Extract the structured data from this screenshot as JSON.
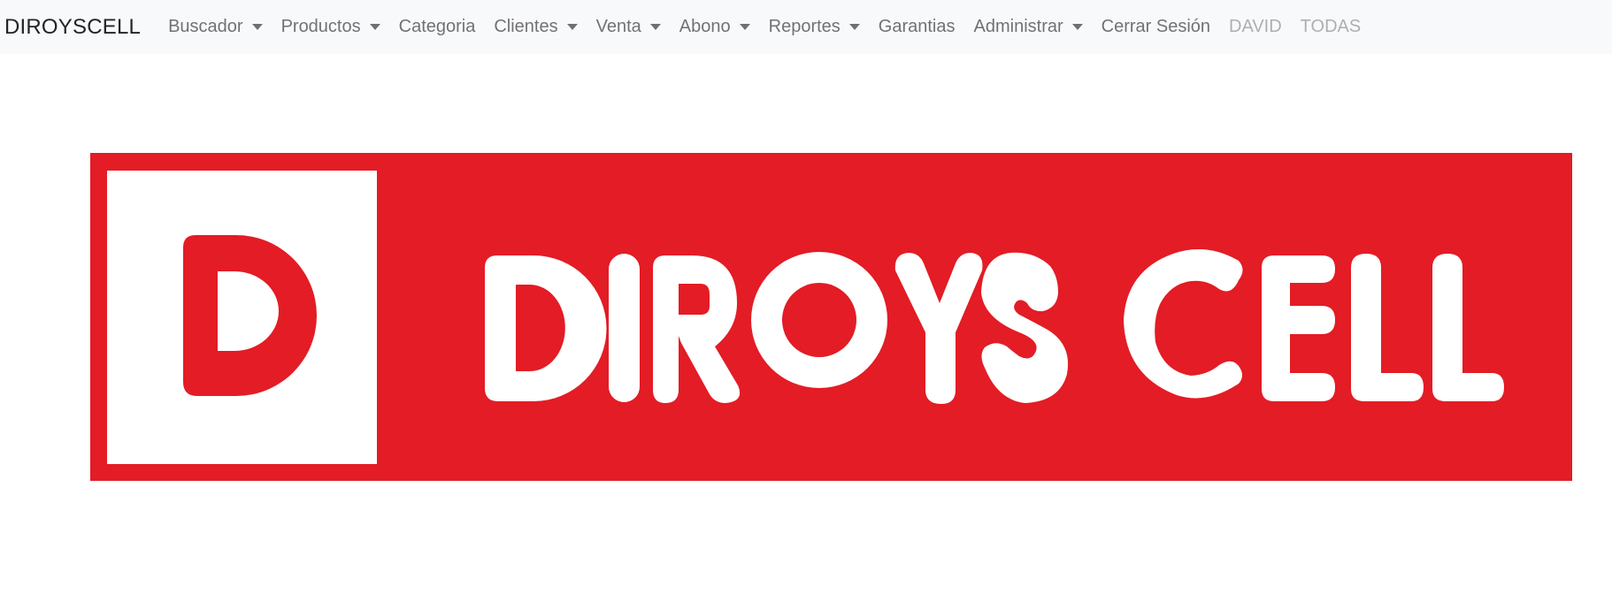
{
  "navbar": {
    "brand": "DIROYSCELL",
    "items": [
      {
        "label": "Buscador",
        "dropdown": true
      },
      {
        "label": "Productos",
        "dropdown": true
      },
      {
        "label": "Categoria",
        "dropdown": false
      },
      {
        "label": "Clientes",
        "dropdown": true
      },
      {
        "label": "Venta",
        "dropdown": true
      },
      {
        "label": "Abono",
        "dropdown": true
      },
      {
        "label": "Reportes",
        "dropdown": true
      },
      {
        "label": "Garantias",
        "dropdown": false
      },
      {
        "label": "Administrar",
        "dropdown": true
      },
      {
        "label": "Cerrar Sesión",
        "dropdown": false
      }
    ],
    "user": "DAVID",
    "store": "TODAS"
  },
  "banner": {
    "logo_letter": "D",
    "logo_text": "DIROYS CELL",
    "brand_color": "#e31c25",
    "background": "#ffffff"
  },
  "colors": {
    "navbar_bg": "#f8f9fa",
    "nav_text": "#6c6c6c",
    "nav_disabled": "#b3b3b3"
  }
}
